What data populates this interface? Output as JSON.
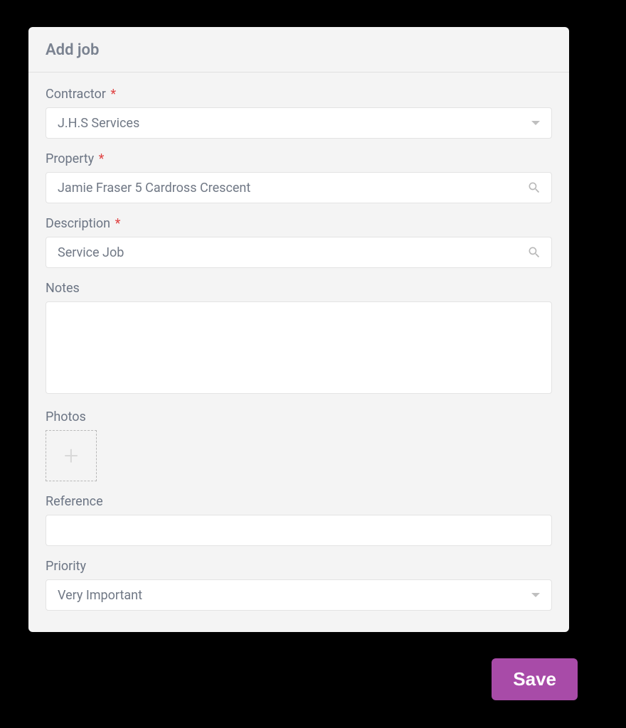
{
  "modal": {
    "title": "Add job"
  },
  "form": {
    "contractor": {
      "label": "Contractor",
      "value": "J.H.S Services",
      "required": true
    },
    "property": {
      "label": "Property",
      "value": "Jamie Fraser 5 Cardross Crescent",
      "required": true
    },
    "description": {
      "label": "Description",
      "value": "Service Job",
      "required": true
    },
    "notes": {
      "label": "Notes",
      "value": ""
    },
    "photos": {
      "label": "Photos"
    },
    "reference": {
      "label": "Reference",
      "value": ""
    },
    "priority": {
      "label": "Priority",
      "value": "Very Important"
    }
  },
  "buttons": {
    "save": "Save"
  }
}
